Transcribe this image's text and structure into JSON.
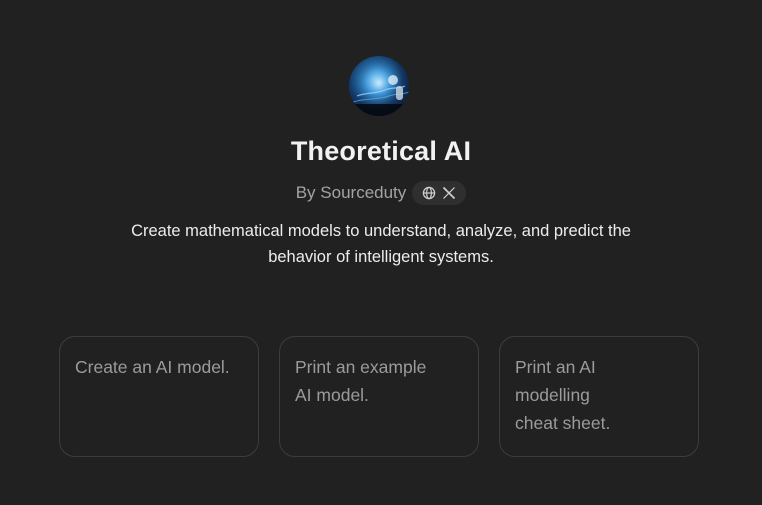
{
  "gpt": {
    "title": "Theoretical AI",
    "author": "By Sourceduty",
    "description": "Create mathematical models to understand, analyze, and predict the behavior of intelligent systems."
  },
  "social_icons": [
    "globe-icon",
    "x-icon"
  ],
  "conversation_starters": [
    "Create an AI model.",
    "Print an example AI model.",
    "Print an AI modelling cheat sheet."
  ],
  "colors": {
    "background": "#212121",
    "card_border": "#3d3d3d",
    "pill_background": "#2f2f2f",
    "muted_text": "#a3a3a3"
  }
}
